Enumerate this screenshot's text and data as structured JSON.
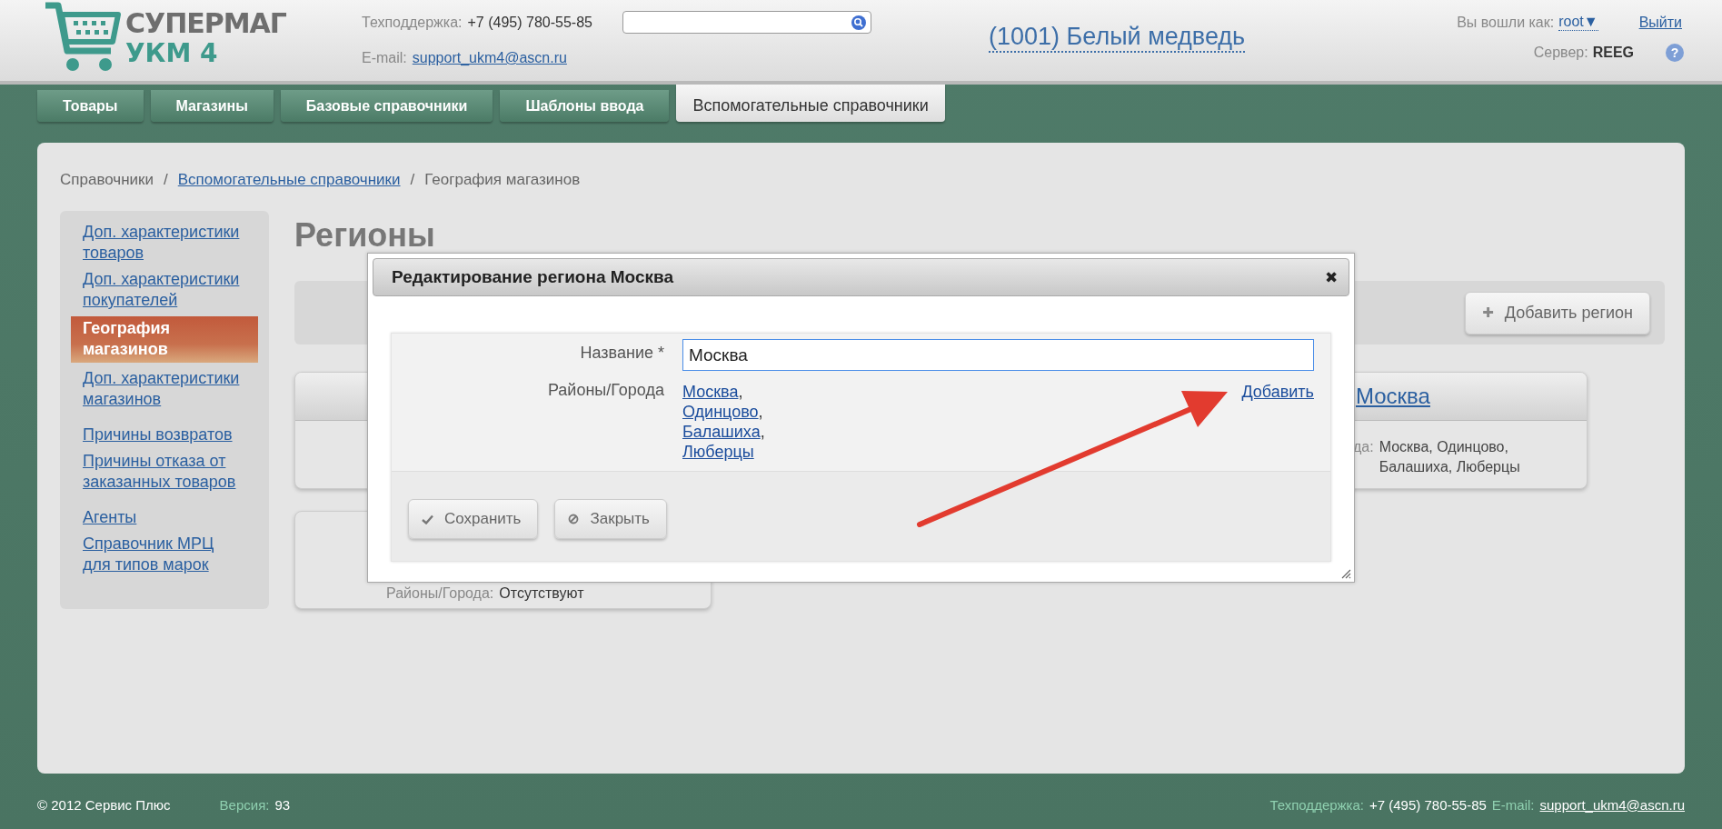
{
  "header": {
    "logo": {
      "line1": "СУПЕРМАГ",
      "line2": "УКМ 4"
    },
    "support": {
      "label": "Техподдержка:",
      "phone": "+7 (495) 780-55-85",
      "email_label": "E-mail:",
      "email": "support_ukm4@ascn.ru"
    },
    "store": "(1001) Белый медведь",
    "user": {
      "label": "Вы вошли как:",
      "name": "root",
      "caret": "▼",
      "logout": "Выйти",
      "server_label": "Сервер:",
      "server": "REEG",
      "help": "?"
    }
  },
  "tabs": [
    {
      "label": "Товары",
      "selected": false
    },
    {
      "label": "Магазины",
      "selected": false
    },
    {
      "label": "Базовые справочники",
      "selected": false
    },
    {
      "label": "Шаблоны ввода",
      "selected": false
    },
    {
      "label": "Вспомогательные справочники",
      "selected": true
    }
  ],
  "breadcrumb": [
    {
      "label": "Справочники",
      "link": false
    },
    {
      "label": "Вспомогательные справочники",
      "link": true
    },
    {
      "label": "География магазинов",
      "link": false
    }
  ],
  "breadcrumb_separator": "/",
  "sidebar": {
    "groups": [
      [
        {
          "label": "Доп. характеристики товаров",
          "selected": false
        },
        {
          "label": "Доп. характеристики покупателей",
          "selected": false
        },
        {
          "label": "География магазинов",
          "selected": true
        },
        {
          "label": "Доп. характеристики магазинов",
          "selected": false
        }
      ],
      [
        {
          "label": "Причины возвратов",
          "selected": false
        },
        {
          "label": "Причины отказа от заказанных товаров",
          "selected": false
        }
      ],
      [
        {
          "label": "Агенты",
          "selected": false
        },
        {
          "label": "Справочник МРЦ для типов марок",
          "selected": false
        }
      ]
    ]
  },
  "page_title": "Регионы",
  "add_button": {
    "icon": "✚",
    "label": "Добавить регион"
  },
  "cards": [
    {
      "title": "Москва",
      "label": "да:",
      "value": "Москва, Одинцово, Балашиха, Люберцы"
    },
    {
      "label": "Районы/Города:",
      "value": "Отсутствуют"
    }
  ],
  "dialog": {
    "title": "Редактирование региона Москва",
    "close": "✖",
    "name_label": "Название *",
    "name_value": "Москва",
    "cities_label": "Районы/Города",
    "cities": [
      {
        "name": "Москва",
        "separator": ","
      },
      {
        "name": "Одинцово",
        "separator": ","
      },
      {
        "name": "Балашиха",
        "separator": ","
      },
      {
        "name": "Люберцы"
      }
    ],
    "add_link": "Добавить",
    "buttons": [
      {
        "kind": "save",
        "label": "Сохранить"
      },
      {
        "kind": "close",
        "label": "Закрыть"
      }
    ]
  },
  "footer": {
    "copyright": "© 2012 Сервис Плюс",
    "version_label": "Версия:",
    "version": "93",
    "support_label": "Техподдержка:",
    "phone": "+7 (495) 780-55-85",
    "email_label": "E-mail:",
    "email": "support_ukm4@ascn.ru"
  }
}
